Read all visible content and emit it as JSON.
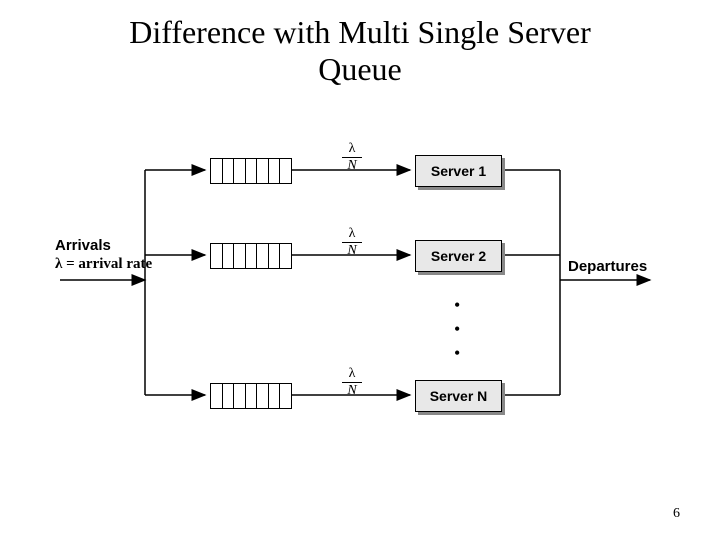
{
  "title_line1": "Difference with Multi Single Server",
  "title_line2": "Queue",
  "arrivals_label": "Arrivals",
  "arrival_rate_label": "λ = arrival rate",
  "departures_label": "Departures",
  "rate_numerator": "λ",
  "rate_denominator": "N",
  "servers": {
    "s1": "Server 1",
    "s2": "Server 2",
    "sN": "Server N"
  },
  "page_number": "6",
  "diagram": {
    "type": "queueing-network",
    "description": "Single arrival stream with rate λ is split evenly into N parallel single-server queues, each receiving rate λ/N, then merged into a single departure stream.",
    "input_rate": "λ",
    "branches": "N",
    "per_branch_rate": "λ / N",
    "branch_components": [
      "FIFO queue",
      "Server i"
    ],
    "shown_servers": [
      "Server 1",
      "Server 2",
      "Server N"
    ],
    "ellipsis_between": [
      "Server 2",
      "Server N"
    ]
  }
}
